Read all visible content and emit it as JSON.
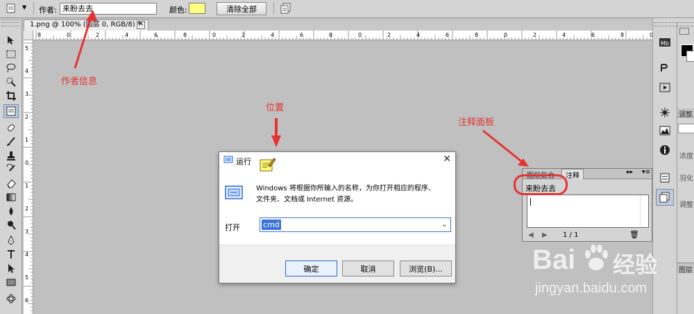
{
  "options_bar": {
    "author_label": "作者:",
    "author_value": "来盼去去",
    "color_label": "颜色:",
    "color_value": "#ffff80",
    "clear_all_label": "清除全部"
  },
  "document": {
    "tab_title": "1.png @ 100% (图层 0, RGB/8) *",
    "ruler_h": [
      "8",
      "0",
      "2",
      "4",
      "6",
      "8",
      "0",
      "2",
      "4",
      "6",
      "8",
      "0",
      "2",
      "4",
      "6",
      "8",
      "0",
      "2",
      "4",
      "6",
      "8",
      "0"
    ],
    "ruler_v": [
      "5",
      "4",
      "3",
      "2",
      "1",
      "0",
      "1",
      "2",
      "3",
      "4",
      "5",
      "6"
    ]
  },
  "annotations": {
    "author_info": "作者信息",
    "position": "位置",
    "notes_panel": "注释面板"
  },
  "run_dialog": {
    "title": "运行",
    "description_line1": "Windows 将根据你所输入的名称，为你打开相应的程序、",
    "description_line2": "文件夹、文档或 Internet 资源。",
    "open_label": "打开",
    "input_value": "cmd",
    "ok_label": "确定",
    "cancel_label": "取消",
    "browse_label": "浏览(B)..."
  },
  "notes_panel": {
    "tab_layer_comps": "图层复合",
    "tab_notes": "注释",
    "author": "来盼去去",
    "page_indicator": "1 / 1"
  },
  "dock": {
    "label_adjust": "调整",
    "label_density": "浓度",
    "label_feather": "羽化",
    "label_refine": "调整",
    "label_layers": "图层"
  },
  "watermark": {
    "brand": "Bai",
    "brand2": "经验",
    "url": "jingyan.baidu.com"
  },
  "colors": {
    "accent_red": "#e53333",
    "note_yellow": "#ffff80",
    "selection_blue": "#3a74d6"
  }
}
